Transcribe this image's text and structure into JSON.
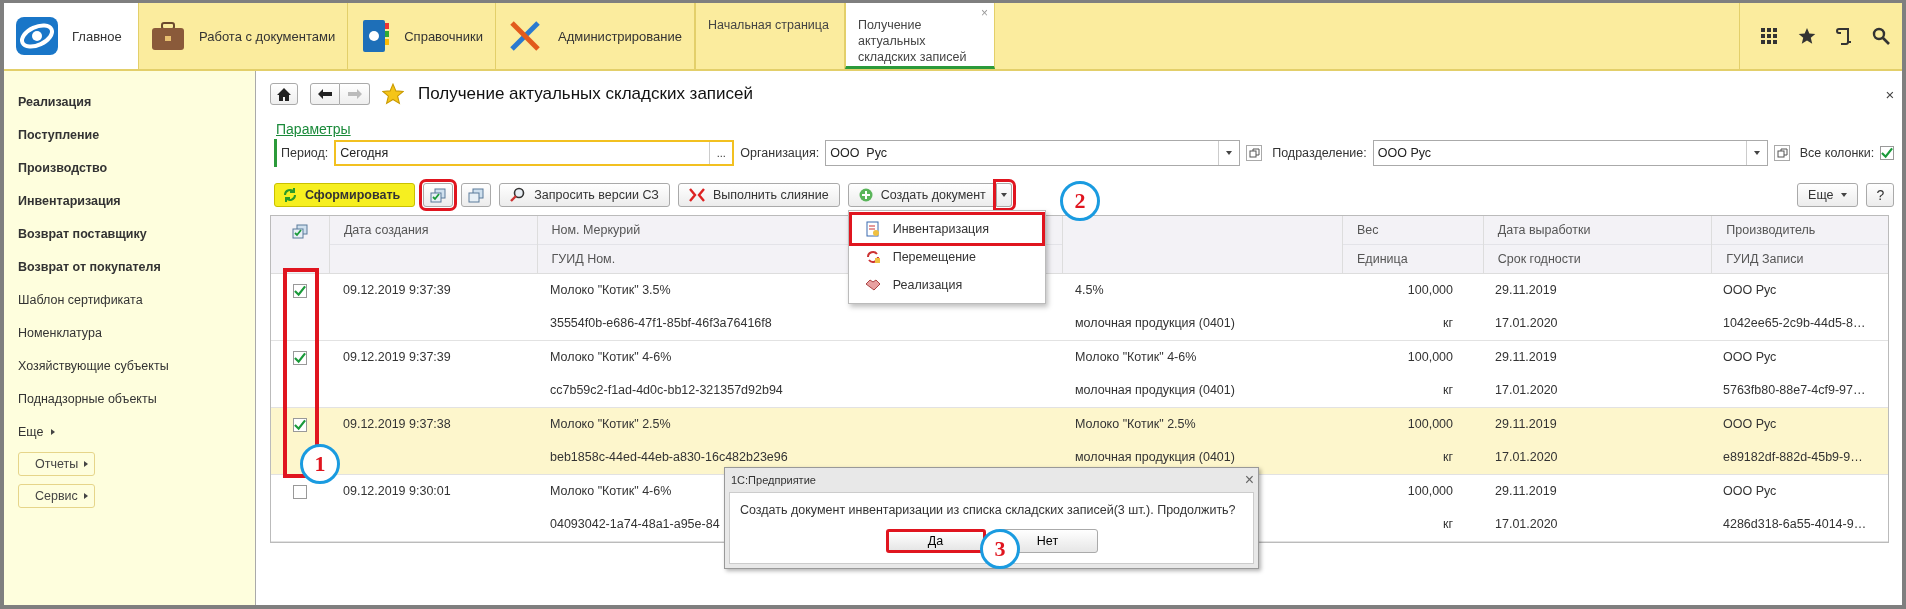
{
  "top_bar": {
    "sections": [
      {
        "label": "Главное",
        "selected": true
      },
      {
        "label": "Работа с документами",
        "selected": false
      },
      {
        "label": "Справочники",
        "selected": false
      },
      {
        "label": "Администрирование",
        "selected": false
      }
    ],
    "tabs": [
      {
        "label": "Начальная страница",
        "selected": false
      },
      {
        "label": "Получение актуальных складских записей",
        "selected": true,
        "close": "×"
      }
    ]
  },
  "sidebar": {
    "items": [
      {
        "label": "Реализация",
        "kind": "section"
      },
      {
        "label": "Поступление",
        "kind": "section"
      },
      {
        "label": "Производство",
        "kind": "section"
      },
      {
        "label": "Инвентаризация",
        "kind": "section"
      },
      {
        "label": "Возврат поставщику",
        "kind": "section"
      },
      {
        "label": "Возврат от покупателя",
        "kind": "section"
      },
      {
        "label": "Шаблон сертификата",
        "kind": "link"
      },
      {
        "label": "Номенклатура",
        "kind": "link"
      },
      {
        "label": "Хозяйствующие субъекты",
        "kind": "link"
      },
      {
        "label": "Поднадзорные объекты",
        "kind": "link"
      },
      {
        "label": "Еще",
        "kind": "more"
      }
    ],
    "buttons": [
      {
        "label": "Отчеты"
      },
      {
        "label": "Сервис"
      }
    ]
  },
  "form": {
    "title": "Получение актуальных складских записей",
    "close": "×",
    "params_link": "Параметры",
    "filters": {
      "period_label": "Период:",
      "period_value": "Сегодня",
      "period_button": "...",
      "org_label": "Организация:",
      "org_value": "ООО  Рус",
      "dept_label": "Подразделение:",
      "dept_value": "ООО Рус",
      "all_columns_label": "Все колонки:",
      "all_columns": true
    },
    "toolbar": [
      {
        "kind": "primary",
        "label": "Сформировать",
        "highlighted": false
      },
      {
        "kind": "checkall",
        "highlighted": true
      },
      {
        "kind": "copy",
        "highlighted": false
      },
      {
        "kind": "request",
        "label": "Запросить версии СЗ",
        "highlighted": false
      },
      {
        "kind": "merge",
        "label": "Выполнить слияние",
        "highlighted": false
      },
      {
        "kind": "split",
        "label": "Создать документ",
        "highlighted": false,
        "arrow_highlighted": true
      }
    ],
    "toolbar_right": [
      {
        "kind": "more",
        "label": "Еще"
      },
      {
        "kind": "help",
        "label": "?"
      }
    ],
    "menu": [
      {
        "label": "Инвентаризация",
        "highlighted": true
      },
      {
        "label": "Перемещение",
        "highlighted": false
      },
      {
        "label": "Реализация",
        "highlighted": false
      }
    ],
    "table": {
      "checks_highlighted": true,
      "columns": [
        {
          "top": "Дата создания"
        },
        {
          "top": "Ном. Меркурий",
          "bottom": "ГУИД Ном."
        },
        {},
        {
          "top": "Вес",
          "bottom": "Единица"
        },
        {
          "top": "Дата выработки",
          "bottom": "Срок годности"
        },
        {
          "top": "Производитель",
          "bottom": "ГУИД Записи"
        }
      ],
      "rows": [
        {
          "checked": true,
          "selected": false,
          "date": "09.12.2019 9:37:39",
          "nom": [
            "Молоко \"Котик\" 3.5%",
            "35554f0b-e686-47f1-85bf-46f3a76416f8"
          ],
          "col3": [
            "4.5%",
            "молочная продукция (0401)"
          ],
          "weight": [
            "100,000",
            "кг"
          ],
          "dates": [
            "29.11.2019",
            "17.01.2020"
          ],
          "maker": [
            "ООО Рус",
            "1042ee65-2c9b-44d5-8…"
          ]
        },
        {
          "checked": true,
          "selected": false,
          "date": "09.12.2019 9:37:39",
          "nom": [
            "Молоко \"Котик\" 4-6%",
            "cc7b59c2-f1ad-4d0c-bb12-321357d92b94"
          ],
          "col3": [
            "Молоко \"Котик\" 4-6%",
            "молочная продукция (0401)"
          ],
          "weight": [
            "100,000",
            "кг"
          ],
          "dates": [
            "29.11.2019",
            "17.01.2020"
          ],
          "maker": [
            "ООО Рус",
            "5763fb80-88e7-4cf9-97…"
          ]
        },
        {
          "checked": true,
          "selected": true,
          "date": "09.12.2019 9:37:38",
          "nom": [
            "Молоко \"Котик\" 2.5%",
            "beb1858c-44ed-44eb-a830-16c482b23e96"
          ],
          "col3": [
            "Молоко \"Котик\" 2.5%",
            "молочная продукция (0401)"
          ],
          "weight": [
            "100,000",
            "кг"
          ],
          "dates": [
            "29.11.2019",
            "17.01.2020"
          ],
          "maker": [
            "ООО Рус",
            "e89182df-882d-45b9-9…"
          ]
        },
        {
          "checked": false,
          "selected": false,
          "date": "09.12.2019 9:30:01",
          "nom": [
            "Молоко \"Котик\" 4-6%",
            "04093042-1a74-48a1-a95e-84"
          ],
          "weight": [
            "100,000",
            "кг"
          ],
          "dates": [
            "29.11.2019",
            "17.01.2020"
          ],
          "maker": [
            "ООО Рус",
            "4286d318-6a55-4014-9…"
          ]
        }
      ]
    },
    "dialog": {
      "title": "1С:Предприятие",
      "close": "×",
      "message": "Создать документ инвентаризации из списка складских записей(3 шт.). Продолжить?",
      "buttons": [
        {
          "label": "Да",
          "highlighted": true
        },
        {
          "label": "Нет",
          "highlighted": false
        }
      ]
    },
    "annotations": [
      {
        "number": "1"
      },
      {
        "number": "2"
      },
      {
        "number": "3"
      }
    ]
  }
}
